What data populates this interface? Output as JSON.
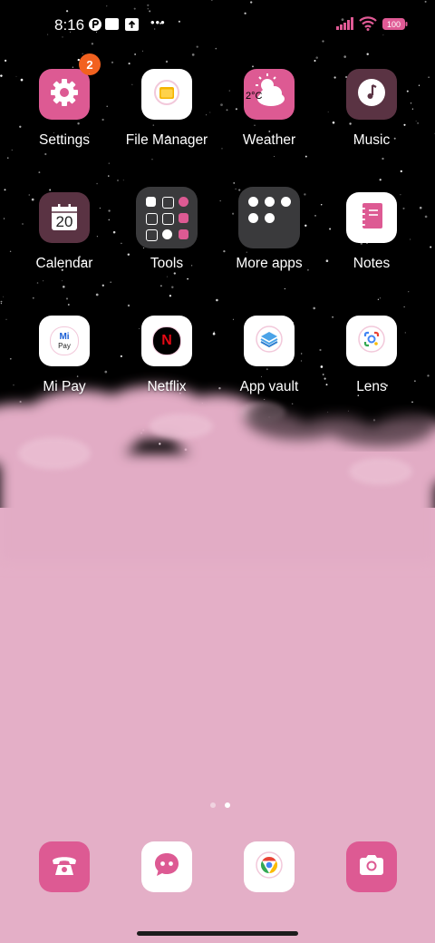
{
  "status_bar": {
    "time": "8:16",
    "battery": "100",
    "more_dots": "•••"
  },
  "apps": {
    "settings": {
      "label": "Settings",
      "badge": "2"
    },
    "file_manager": {
      "label": "File Manager"
    },
    "weather": {
      "label": "Weather",
      "tile_text": "2°C"
    },
    "music": {
      "label": "Music"
    },
    "calendar": {
      "label": "Calendar",
      "day": "20"
    },
    "tools": {
      "label": "Tools"
    },
    "more_apps": {
      "label": "More apps"
    },
    "notes": {
      "label": "Notes"
    },
    "mi_pay": {
      "label": "Mi Pay",
      "logo_top": "Mi",
      "logo_bottom": "Pay"
    },
    "netflix": {
      "label": "Netflix",
      "logo": "N"
    },
    "app_vault": {
      "label": "App vault"
    },
    "lens": {
      "label": "Lens"
    }
  },
  "page_indicator": {
    "count": 2,
    "active_index": 1
  },
  "colors": {
    "accent_pink": "#dd5a93",
    "wallpaper_pink": "#e4afc7",
    "dark_plum": "#5a3343",
    "badge_orange": "#f2611f"
  }
}
